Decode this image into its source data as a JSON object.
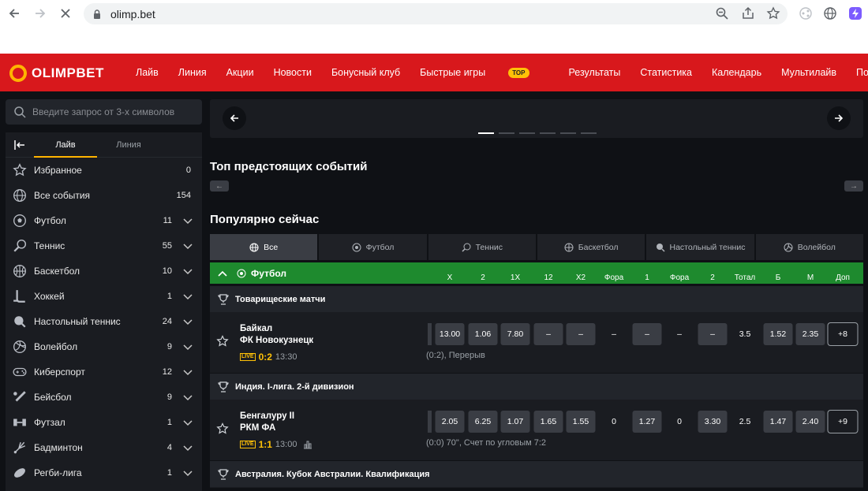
{
  "browser": {
    "url": "olimp.bet"
  },
  "header": {
    "logo_text": "OLIMPBET",
    "menu": [
      "Лайв",
      "Линия",
      "Акции",
      "Новости",
      "Бонусный клуб",
      "Быстрые игры",
      "Результаты",
      "Статистика",
      "Календарь",
      "Мультилайв",
      "Помощь"
    ],
    "top_badge": "TOP",
    "accent_color": "#d8181c"
  },
  "sidebar": {
    "search_placeholder": "Введите запрос от 3-х символов",
    "tabs": [
      "Лайв",
      "Линия"
    ],
    "items": [
      {
        "label": "Избранное",
        "count": "0",
        "icon": "star-icon"
      },
      {
        "label": "Все события",
        "count": "154",
        "icon": "globe-icon"
      },
      {
        "label": "Футбол",
        "count": "11",
        "icon": "football-icon"
      },
      {
        "label": "Теннис",
        "count": "55",
        "icon": "tennis-icon"
      },
      {
        "label": "Баскетбол",
        "count": "10",
        "icon": "basketball-icon"
      },
      {
        "label": "Хоккей",
        "count": "1",
        "icon": "hockey-icon"
      },
      {
        "label": "Настольный теннис",
        "count": "24",
        "icon": "table-tennis-icon"
      },
      {
        "label": "Волейбол",
        "count": "9",
        "icon": "volleyball-icon"
      },
      {
        "label": "Киберспорт",
        "count": "12",
        "icon": "gamepad-icon"
      },
      {
        "label": "Бейсбол",
        "count": "9",
        "icon": "baseball-icon"
      },
      {
        "label": "Футзал",
        "count": "1",
        "icon": "futsal-icon"
      },
      {
        "label": "Бадминтон",
        "count": "4",
        "icon": "badminton-icon"
      },
      {
        "label": "Регби-лига",
        "count": "1",
        "icon": "rugby-icon"
      }
    ]
  },
  "main": {
    "top_events_title": "Топ предстоящих событий",
    "popular_title": "Популярно сейчас",
    "filter_tabs": [
      "Все",
      "Футбол",
      "Теннис",
      "Баскетбол",
      "Настольный теннис",
      "Волейбол"
    ],
    "group": {
      "title": "Футбол",
      "columns": [
        "Х",
        "2",
        "1Х",
        "12",
        "Х2",
        "Фора",
        "1",
        "Фора",
        "2",
        "Тотал",
        "Б",
        "М",
        "Доп"
      ]
    },
    "leagues": [
      {
        "title": "Товарищеские матчи",
        "event": {
          "team1": "Байкал",
          "team2": "ФК Новокузнецк",
          "live_badge": "LIVE",
          "score": "0:2",
          "time": "13:30",
          "info": "(0:2), Перерыв",
          "odds": [
            "13.00",
            "1.06",
            "7.80",
            "–",
            "–",
            "–",
            "–",
            "–",
            "–",
            "3.5",
            "1.52",
            "2.35"
          ],
          "more": "+8"
        }
      },
      {
        "title": "Индия. I-лига. 2-й дивизион",
        "event": {
          "team1": "Бенгалуру II",
          "team2": "РКМ ФА",
          "live_badge": "LIVE",
          "score": "1:1",
          "time": "13:00",
          "info": "(0:0) 70\", Счет по угловым 7:2",
          "odds": [
            "2.05",
            "6.25",
            "1.07",
            "1.65",
            "1.55",
            "0",
            "1.27",
            "0",
            "3.30",
            "2.5",
            "1.47",
            "2.40"
          ],
          "more": "+9"
        }
      },
      {
        "title": "Австралия. Кубок Австралии. Квалификация"
      }
    ]
  }
}
